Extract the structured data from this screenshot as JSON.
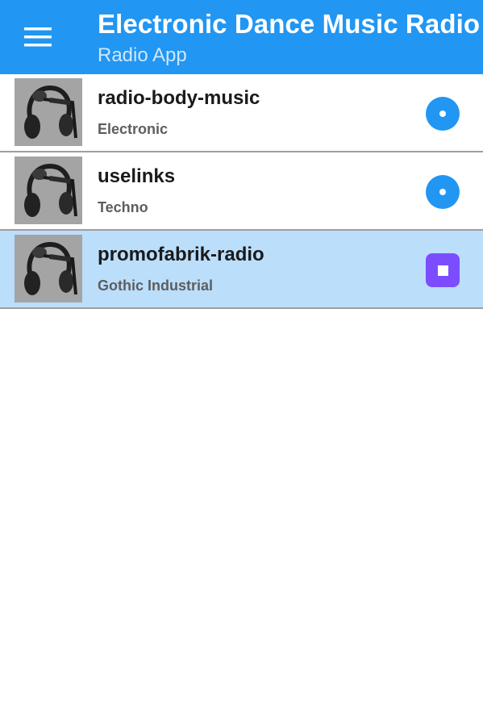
{
  "app_bar": {
    "title": "Electronic Dance Music Radio",
    "subtitle": "Radio App",
    "menu_icon": "hamburger-menu-icon",
    "background_color": "#2196f3"
  },
  "stations": [
    {
      "name": "radio-body-music",
      "genre": "Electronic",
      "state": "idle",
      "action_icon": "play-icon"
    },
    {
      "name": "uselinks",
      "genre": "Techno",
      "state": "idle",
      "action_icon": "play-icon"
    },
    {
      "name": "promofabrik-radio",
      "genre": "Gothic Industrial",
      "state": "playing",
      "action_icon": "stop-icon"
    }
  ],
  "colors": {
    "accent": "#2196f3",
    "selected_row": "#bbdefb",
    "stop_button": "#7c4dff"
  }
}
